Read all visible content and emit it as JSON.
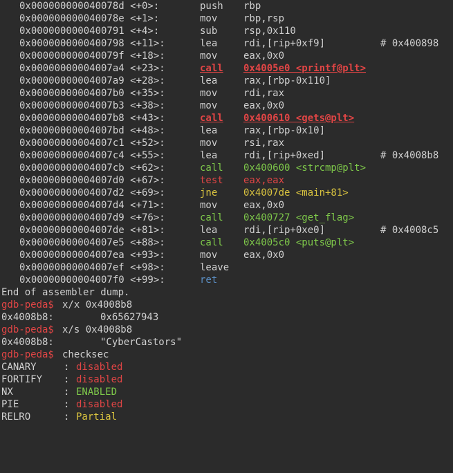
{
  "disasm": [
    {
      "addr": "0x000000000040078d <+0>:",
      "mnem": "push",
      "ops": "rbp",
      "comment": ""
    },
    {
      "addr": "0x000000000040078e <+1>:",
      "mnem": "mov",
      "ops": "rbp,rsp",
      "comment": ""
    },
    {
      "addr": "0x0000000000400791 <+4>:",
      "mnem": "sub",
      "ops": "rsp,0x110",
      "comment": ""
    },
    {
      "addr": "0x0000000000400798 <+11>:",
      "mnem": "lea",
      "ops": "rdi,[rip+0xf9]",
      "comment": "# 0x400898"
    },
    {
      "addr": "0x000000000040079f <+18>:",
      "mnem": "mov",
      "ops": "eax,0x0",
      "comment": ""
    },
    {
      "addr": "0x00000000004007a4 <+23>:",
      "mnem": "call",
      "ops": "0x4005e0 <printf@plt>",
      "comment": ""
    },
    {
      "addr": "0x00000000004007a9 <+28>:",
      "mnem": "lea",
      "ops": "rax,[rbp-0x110]",
      "comment": ""
    },
    {
      "addr": "0x00000000004007b0 <+35>:",
      "mnem": "mov",
      "ops": "rdi,rax",
      "comment": ""
    },
    {
      "addr": "0x00000000004007b3 <+38>:",
      "mnem": "mov",
      "ops": "eax,0x0",
      "comment": ""
    },
    {
      "addr": "0x00000000004007b8 <+43>:",
      "mnem": "call",
      "ops": "0x400610 <gets@plt>",
      "comment": ""
    },
    {
      "addr": "0x00000000004007bd <+48>:",
      "mnem": "lea",
      "ops": "rax,[rbp-0x10]",
      "comment": ""
    },
    {
      "addr": "0x00000000004007c1 <+52>:",
      "mnem": "mov",
      "ops": "rsi,rax",
      "comment": ""
    },
    {
      "addr": "0x00000000004007c4 <+55>:",
      "mnem": "lea",
      "ops": "rdi,[rip+0xed]",
      "comment": "# 0x4008b8"
    },
    {
      "addr": "0x00000000004007cb <+62>:",
      "mnem": "call",
      "ops": "0x400600 <strcmp@plt>",
      "comment": ""
    },
    {
      "addr": "0x00000000004007d0 <+67>:",
      "mnem": "test",
      "ops": "eax,eax",
      "comment": ""
    },
    {
      "addr": "0x00000000004007d2 <+69>:",
      "mnem": "jne",
      "ops": "0x4007de <main+81>",
      "comment": ""
    },
    {
      "addr": "0x00000000004007d4 <+71>:",
      "mnem": "mov",
      "ops": "eax,0x0",
      "comment": ""
    },
    {
      "addr": "0x00000000004007d9 <+76>:",
      "mnem": "call",
      "ops": "0x400727 <get_flag>",
      "comment": ""
    },
    {
      "addr": "0x00000000004007de <+81>:",
      "mnem": "lea",
      "ops": "rdi,[rip+0xe0]",
      "comment": "# 0x4008c5"
    },
    {
      "addr": "0x00000000004007e5 <+88>:",
      "mnem": "call",
      "ops": "0x4005c0 <puts@plt>",
      "comment": ""
    },
    {
      "addr": "0x00000000004007ea <+93>:",
      "mnem": "mov",
      "ops": "eax,0x0",
      "comment": ""
    },
    {
      "addr": "0x00000000004007ef <+98>:",
      "mnem": "leave",
      "ops": "",
      "comment": ""
    },
    {
      "addr": "0x00000000004007f0 <+99>:",
      "mnem": "ret",
      "ops": "",
      "comment": ""
    }
  ],
  "end_message": "End of assembler dump.",
  "prompt": "gdb-peda$",
  "cmd1": "x/x 0x4008b8",
  "cmd1_out_addr": "0x4008b8:",
  "cmd1_out_val": "0x65627943",
  "cmd2": "x/s 0x4008b8",
  "cmd2_out_addr": "0x4008b8:",
  "cmd2_out_val": "\"CyberCastors\"",
  "cmd3": "checksec",
  "checksec": [
    {
      "name": "CANARY",
      "value": "disabled",
      "status": "bad"
    },
    {
      "name": "FORTIFY",
      "value": "disabled",
      "status": "bad"
    },
    {
      "name": "NX",
      "value": "ENABLED",
      "status": "good"
    },
    {
      "name": "PIE",
      "value": "disabled",
      "status": "bad"
    },
    {
      "name": "RELRO",
      "value": "Partial",
      "status": "partial"
    }
  ],
  "colors": {
    "background": "#2b2b2b",
    "text": "#d0d0d0",
    "red": "#e04545",
    "green": "#7ec84a",
    "yellow": "#d9c33f",
    "blue": "#5b8fc4"
  }
}
